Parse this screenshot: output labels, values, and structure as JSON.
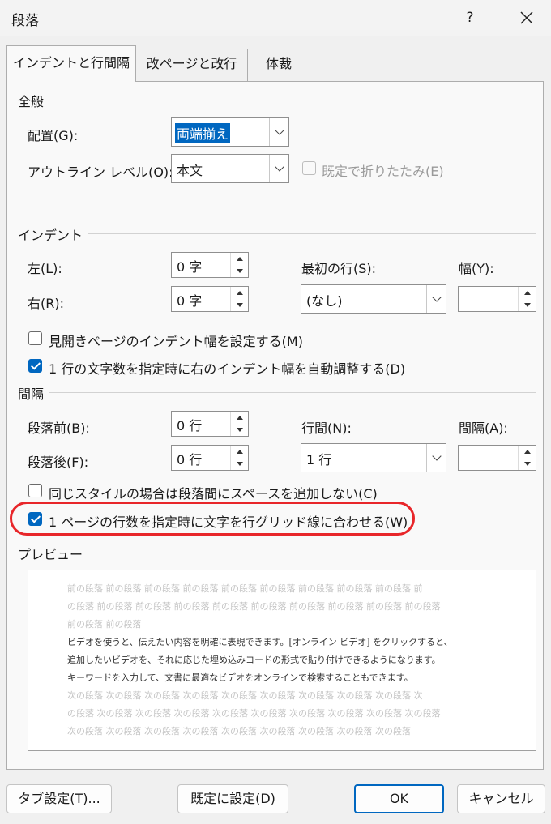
{
  "window": {
    "title": "段落",
    "help_label": "?"
  },
  "tabs": [
    {
      "label": "インデントと行間隔",
      "active": true
    },
    {
      "label": "改ページと改行",
      "active": false
    },
    {
      "label": "体裁",
      "active": false
    }
  ],
  "general": {
    "heading": "全般",
    "alignment": {
      "label": "配置(G):",
      "value": "両端揃え"
    },
    "outline": {
      "label": "アウトライン レベル(O):",
      "value": "本文"
    },
    "collapse": {
      "label": "既定で折りたたみ(E)",
      "checked": false,
      "enabled": false
    }
  },
  "indent": {
    "heading": "インデント",
    "left": {
      "label": "左(L):",
      "value": "0 字"
    },
    "right": {
      "label": "右(R):",
      "value": "0 字"
    },
    "first_line": {
      "label": "最初の行(S):",
      "value": "(なし)"
    },
    "width": {
      "label": "幅(Y):",
      "value": ""
    },
    "mirror": {
      "label": "見開きページのインデント幅を設定する(M)",
      "checked": false
    },
    "auto_adjust": {
      "label": "1 行の文字数を指定時に右のインデント幅を自動調整する(D)",
      "checked": true
    }
  },
  "spacing": {
    "heading": "間隔",
    "before": {
      "label": "段落前(B):",
      "value": "0 行"
    },
    "after": {
      "label": "段落後(F):",
      "value": "0 行"
    },
    "line_spacing": {
      "label": "行間(N):",
      "value": "1 行"
    },
    "at": {
      "label": "間隔(A):",
      "value": ""
    },
    "no_space_same_style": {
      "label": "同じスタイルの場合は段落間にスペースを追加しない(C)",
      "checked": false
    },
    "snap_to_grid": {
      "label": "1 ページの行数を指定時に文字を行グリッド線に合わせる(W)",
      "checked": true
    }
  },
  "preview": {
    "heading": "プレビュー",
    "prev_lines": [
      "前の段落 前の段落 前の段落 前の段落 前の段落 前の段落 前の段落 前の段落 前の段落 前",
      "の段落 前の段落 前の段落 前の段落 前の段落 前の段落 前の段落 前の段落 前の段落 前の段落",
      "前の段落 前の段落"
    ],
    "sample_lines": [
      "ビデオを使うと、伝えたい内容を明確に表現できます。[オンライン ビデオ] をクリックすると、",
      "追加したいビデオを、それに応じた埋め込みコードの形式で貼り付けできるようになります。",
      "キーワードを入力して、文書に最適なビデオをオンラインで検索することもできます。"
    ],
    "next_lines": [
      "次の段落 次の段落 次の段落 次の段落 次の段落 次の段落 次の段落 次の段落 次の段落 次",
      "の段落 次の段落 次の段落 次の段落 次の段落 次の段落 次の段落 次の段落 次の段落 次の段落",
      "次の段落 次の段落 次の段落 次の段落 次の段落 次の段落 次の段落 次の段落 次の段落"
    ]
  },
  "buttons": {
    "tabs": "タブ設定(T)...",
    "set_default": "既定に設定(D)",
    "ok": "OK",
    "cancel": "キャンセル"
  },
  "colors": {
    "accent": "#0067c0",
    "highlight": "#e8262a"
  }
}
